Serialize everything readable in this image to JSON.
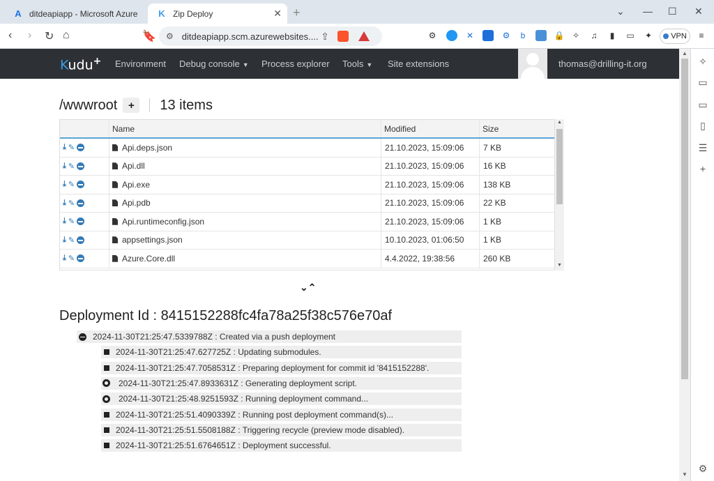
{
  "browser": {
    "tabs": [
      {
        "title": "ditdeapiapp - Microsoft Azure",
        "icon": "azure-icon",
        "active": false
      },
      {
        "title": "Zip Deploy",
        "icon": "kudu-icon",
        "active": true
      }
    ],
    "url": "ditdeapiapp.scm.azurewebsites....",
    "vpn_label": "VPN"
  },
  "kudu": {
    "logo": "kudu",
    "logo_plus": "+",
    "nav": [
      "Environment",
      "Debug console",
      "Process explorer",
      "Tools",
      "Site extensions"
    ],
    "user": "thomas@drilling-it.org"
  },
  "explorer": {
    "path": "/wwwroot",
    "add_label": "+",
    "item_count": "13 items",
    "columns": [
      "Name",
      "Modified",
      "Size"
    ],
    "files": [
      {
        "name": "Api.deps.json",
        "modified": "21.10.2023, 15:09:06",
        "size": "7 KB"
      },
      {
        "name": "Api.dll",
        "modified": "21.10.2023, 15:09:06",
        "size": "16 KB"
      },
      {
        "name": "Api.exe",
        "modified": "21.10.2023, 15:09:06",
        "size": "138 KB"
      },
      {
        "name": "Api.pdb",
        "modified": "21.10.2023, 15:09:06",
        "size": "22 KB"
      },
      {
        "name": "Api.runtimeconfig.json",
        "modified": "21.10.2023, 15:09:06",
        "size": "1 KB"
      },
      {
        "name": "appsettings.json",
        "modified": "10.10.2023, 01:06:50",
        "size": "1 KB"
      },
      {
        "name": "Azure.Core.dll",
        "modified": "4.4.2022, 19:38:56",
        "size": "260 KB"
      }
    ]
  },
  "deployment": {
    "title": "Deployment Id : 8415152288fc4fa78a25f38c576e70af",
    "root_log": "2024-11-30T21:25:47.5339788Z : Created via a push deployment",
    "logs": [
      {
        "text": "2024-11-30T21:25:47.627725Z : Updating submodules.",
        "bullet": "square"
      },
      {
        "text": "2024-11-30T21:25:47.7058531Z : Preparing deployment for commit id '8415152288'.",
        "bullet": "square"
      },
      {
        "text": "2024-11-30T21:25:47.8933631Z : Generating deployment script.",
        "bullet": "ring"
      },
      {
        "text": "2024-11-30T21:25:48.9251593Z : Running deployment command...",
        "bullet": "ring"
      },
      {
        "text": "2024-11-30T21:25:51.4090339Z : Running post deployment command(s)...",
        "bullet": "square"
      },
      {
        "text": "2024-11-30T21:25:51.5508188Z : Triggering recycle (preview mode disabled).",
        "bullet": "square"
      },
      {
        "text": "2024-11-30T21:25:51.6764651Z : Deployment successful.",
        "bullet": "square"
      }
    ]
  },
  "colors": {
    "nav_bg": "#2d3136",
    "accent": "#337ab7",
    "header_underline": "#5aa5d8"
  }
}
